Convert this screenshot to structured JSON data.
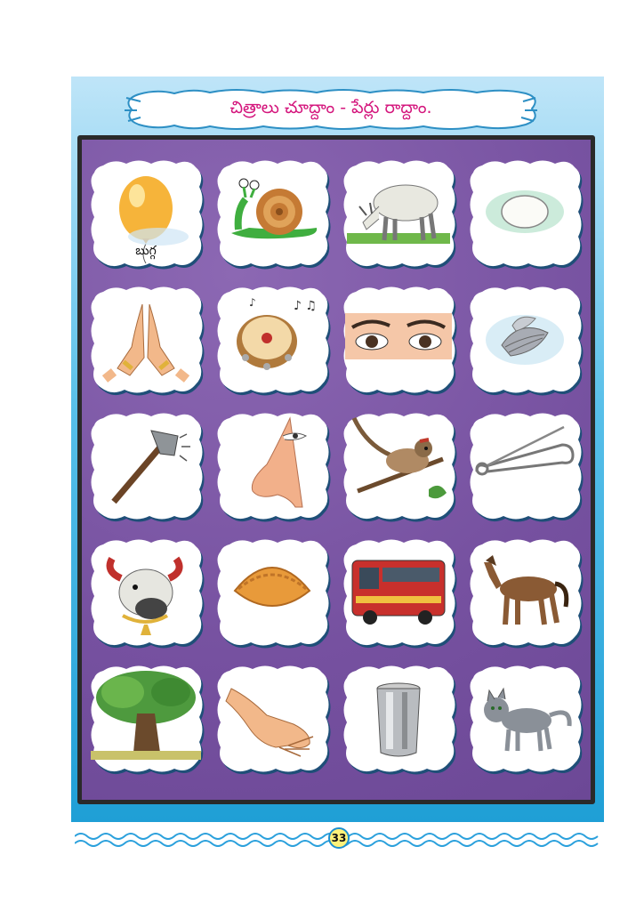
{
  "header": {
    "title": "చిత్రాలు చూద్దాం - పేర్లు రాద్దాం."
  },
  "cards": [
    {
      "label": "బుగ్గ",
      "icon": "balloon-icon"
    },
    {
      "label": "",
      "icon": "snail-icon"
    },
    {
      "label": "",
      "icon": "ox-grazing-icon"
    },
    {
      "label": "",
      "icon": "egg-icon"
    },
    {
      "label": "",
      "icon": "namaste-hands-icon"
    },
    {
      "label": "",
      "icon": "tambourine-icon"
    },
    {
      "label": "",
      "icon": "eyes-icon"
    },
    {
      "label": "",
      "icon": "oyster-shell-icon"
    },
    {
      "label": "",
      "icon": "axe-icon"
    },
    {
      "label": "",
      "icon": "nose-icon"
    },
    {
      "label": "",
      "icon": "sparrow-icon"
    },
    {
      "label": "",
      "icon": "safety-pin-icon"
    },
    {
      "label": "",
      "icon": "cow-head-icon"
    },
    {
      "label": "",
      "icon": "kajjikaya-sweet-icon"
    },
    {
      "label": "",
      "icon": "bus-icon"
    },
    {
      "label": "",
      "icon": "horse-icon"
    },
    {
      "label": "",
      "icon": "tree-icon"
    },
    {
      "label": "",
      "icon": "hand-icon"
    },
    {
      "label": "",
      "icon": "steel-tumbler-icon"
    },
    {
      "label": "",
      "icon": "cat-icon"
    }
  ],
  "footer": {
    "page_number": "33"
  },
  "colors": {
    "title": "#d4157c",
    "board": "#7b55a4",
    "panel": "#1f9fd6",
    "card_border": "#1f5f8f"
  }
}
